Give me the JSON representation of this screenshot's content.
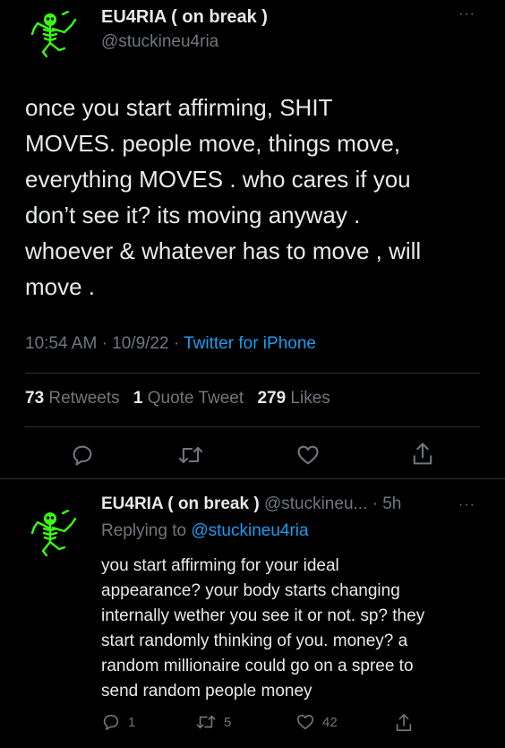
{
  "main_tweet": {
    "display_name": "EU4RIA ( on break )",
    "handle": "@stuckineu4ria",
    "text": "once you start affirming, SHIT\nMOVES. people move, things move,\neverything MOVES . who cares if you\ndon’t see it? its moving anyway .\nwhoever & whatever has to move , will\nmove .",
    "time": "10:54 AM",
    "date": "10/9/22",
    "separator": "·",
    "source": "Twitter for iPhone",
    "retweets_count": "73",
    "retweets_label": "Retweets",
    "quotes_count": "1",
    "quotes_label": "Quote Tweet",
    "likes_count": "279",
    "likes_label": "Likes",
    "more_glyph": "···"
  },
  "reply_tweet": {
    "display_name": "EU4RIA ( on break )",
    "handle_time": "@stuckineu... · 5h",
    "replying_prefix": "Replying to",
    "replying_mention": "@stuckineu4ria",
    "text": "you start affirming for your ideal\nappearance? your body starts changing\ninternally wether you see it or not. sp? they\nstart randomly thinking of you. money? a\nrandom millionaire could go on a spree to\nsend random people money",
    "reply_count": "1",
    "retweet_count": "5",
    "like_count": "42",
    "more_glyph": "···"
  },
  "icons": {
    "reply": "reply-icon",
    "retweet": "retweet-icon",
    "like": "heart-icon",
    "share": "share-icon",
    "avatar": "skeleton-avatar"
  },
  "colors": {
    "background": "#000000",
    "text": "#e7e9ea",
    "secondary": "#71767b",
    "link": "#1d9bf0",
    "divider": "#2f3336",
    "avatar_green": "#39ff14"
  }
}
